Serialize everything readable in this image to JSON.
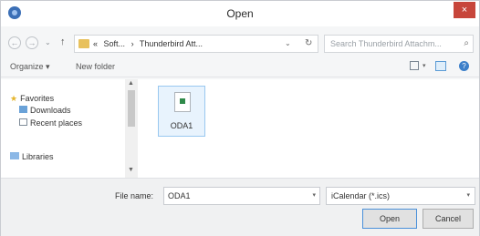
{
  "window": {
    "title": "Open",
    "close": "×"
  },
  "addressbar": {
    "back": "←",
    "forward": "→",
    "dropdown": "⌄",
    "up": "↑",
    "crumbs": [
      "«",
      "Soft...",
      "›",
      "Thunderbird Att..."
    ],
    "address_dropdown": "⌄",
    "refresh": "↻",
    "search_placeholder": "Search Thunderbird Attachm...",
    "search_icon": "⌕"
  },
  "toolbar": {
    "organize": "Organize ▾",
    "new_folder": "New folder",
    "view_arrow": "▾",
    "help": "?"
  },
  "nav": {
    "favorites": "Favorites",
    "downloads": "Downloads",
    "recent_places": "Recent places",
    "libraries": "Libraries"
  },
  "scrollbar": {
    "up": "▲",
    "down": "▼"
  },
  "files": [
    {
      "name": "ODA1",
      "icon": "calendar-file-icon"
    }
  ],
  "bottom": {
    "filename_label": "File name:",
    "filename_value": "ODA1",
    "filename_arrow": "▾",
    "filetype_value": "iCalendar (*.ics)",
    "filetype_arrow": "▾",
    "open_label": "Open",
    "cancel_label": "Cancel"
  }
}
